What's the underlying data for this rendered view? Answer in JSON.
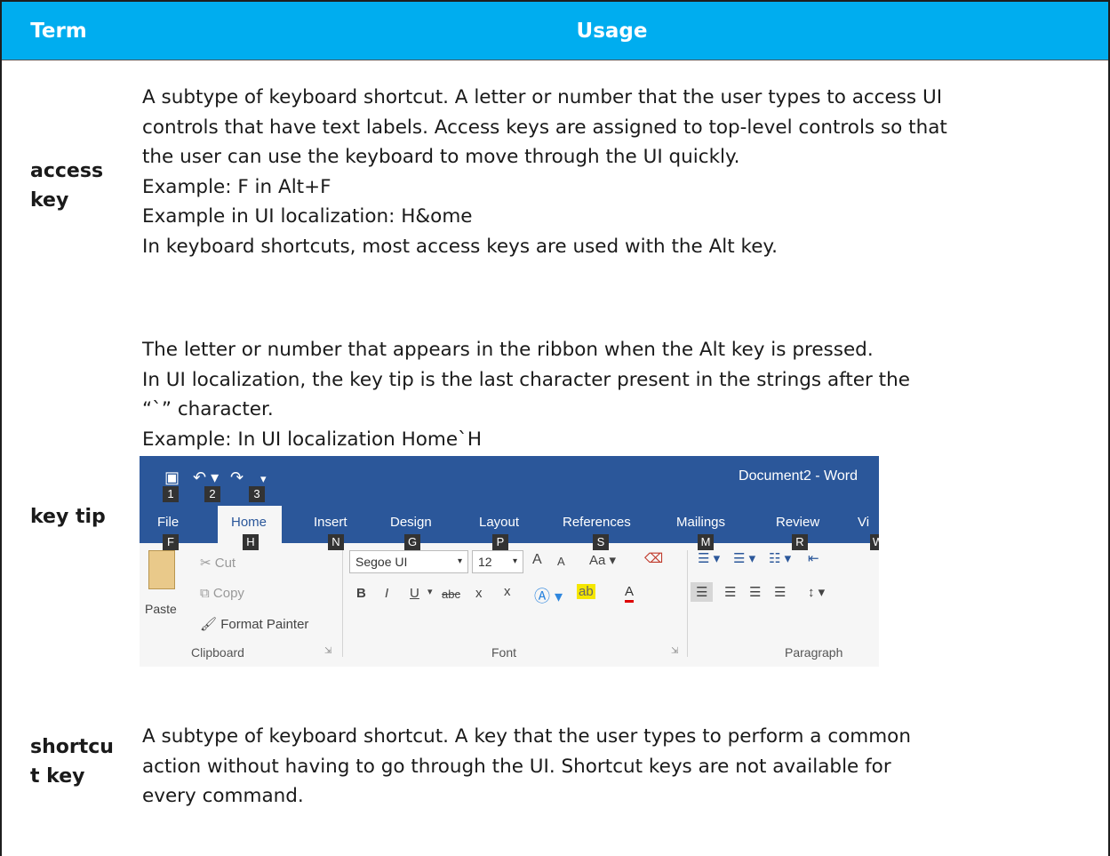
{
  "header": {
    "term": "Term",
    "usage": "Usage"
  },
  "rows": [
    {
      "term_lines": [
        "access",
        "key"
      ],
      "usage_lines": [
        "A subtype of keyboard shortcut. A letter or number that the user types to access UI",
        "controls that have text labels. Access keys are assigned to top-level controls so that",
        "the user can use the keyboard to move through the UI quickly.",
        "Example: F in Alt+F",
        "Example in UI localization: H&ome",
        "In keyboard shortcuts, most access keys are used with the Alt key."
      ]
    },
    {
      "term": "key tip",
      "usage_lines": [
        "The letter or number that appears in the ribbon when the Alt key is pressed.",
        "In UI localization, the key tip is the last character present in the strings after the",
        "“`” character.",
        "Example: In UI localization Home`H"
      ]
    },
    {
      "term_lines": [
        "shortcu",
        "t key"
      ],
      "usage_lines": [
        "A subtype of keyboard shortcut. A key that the user types to perform a common",
        "action without having to go through the UI. Shortcut keys are not available for",
        "every command."
      ]
    }
  ],
  "ribbon": {
    "title": "Document2 - Word",
    "qat_keytips": [
      "1",
      "2",
      "3"
    ],
    "tabs": [
      {
        "label": "File",
        "keytip": "F"
      },
      {
        "label": "Home",
        "keytip": "H"
      },
      {
        "label": "Insert",
        "keytip": "N"
      },
      {
        "label": "Design",
        "keytip": "G"
      },
      {
        "label": "Layout",
        "keytip": "P"
      },
      {
        "label": "References",
        "keytip": "S"
      },
      {
        "label": "Mailings",
        "keytip": "M"
      },
      {
        "label": "Review",
        "keytip": "R"
      },
      {
        "label": "Vi",
        "keytip": "W"
      }
    ],
    "clipboard": {
      "cut": "Cut",
      "copy": "Copy",
      "paste": "Paste",
      "format_painter": "Format Painter",
      "group": "Clipboard"
    },
    "font": {
      "name": "Segoe UI",
      "size": "12",
      "group": "Font",
      "grow": "A",
      "shrink": "A",
      "case": "Aa",
      "bold": "B",
      "italic": "I",
      "underline": "U",
      "strike": "abc",
      "sub": "x",
      "sup": "x"
    },
    "paragraph": {
      "group": "Paragraph"
    }
  }
}
